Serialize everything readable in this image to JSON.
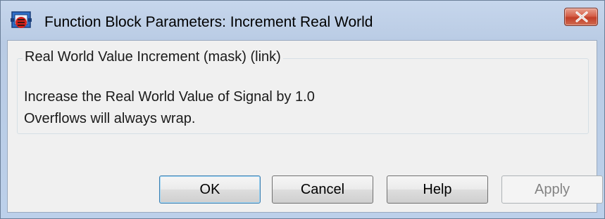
{
  "window": {
    "title": "Function Block Parameters: Increment Real World",
    "icon": "simulink-block-icon",
    "close_icon": "close-icon"
  },
  "mask": {
    "legend": "Real World Value Increment (mask) (link)",
    "description_lines": [
      "Increase the Real World Value of Signal by 1.0",
      "Overflows will always wrap."
    ]
  },
  "buttons": {
    "ok": "OK",
    "cancel": "Cancel",
    "help": "Help",
    "apply": "Apply"
  },
  "colors": {
    "title_bar": "#c6d6ec",
    "close_button": "#c94a33",
    "dialog_background": "#f0f0f0",
    "default_button_border": "#3c7fb1",
    "disabled_text": "#838383"
  }
}
